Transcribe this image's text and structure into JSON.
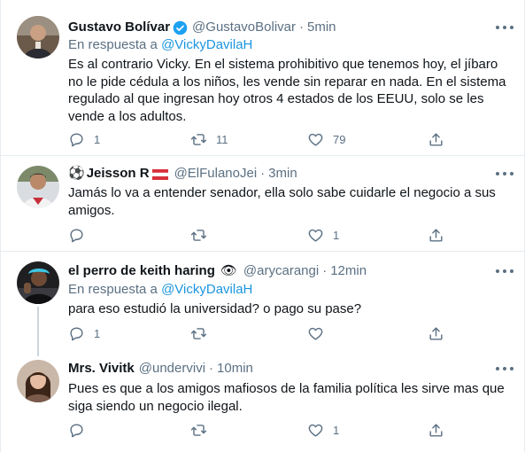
{
  "tweets": [
    {
      "name": "Gustavo Bolívar",
      "handle": "@GustavoBolivar",
      "dot": "·",
      "time": "5min",
      "verified": true,
      "reply_prefix": "En respuesta a ",
      "reply_to": "@VickyDavilaH",
      "text": "Es al contrario Vicky. En el sistema prohibitivo que tenemos hoy, el jíbaro no le pide cédula a los niños, les vende sin reparar en nada. En el sistema regulado al que ingresan hoy otros 4 estados de los EEUU, solo se les vende a los adultos.",
      "replies": "1",
      "retweets": "11",
      "likes": "79"
    },
    {
      "name_prefix_emoji": "⚽",
      "name": "Jeisson R",
      "name_suffix_emoji": "🇦🇹",
      "handle": "@ElFulanoJei",
      "dot": "·",
      "time": "3min",
      "text": "Jamás lo va a entender senador, ella solo sabe cuidarle el negocio a sus amigos.",
      "replies": "",
      "retweets": "",
      "likes": "1"
    },
    {
      "name": "el perro de keith haring",
      "name_suffix_emoji": "👁",
      "handle": "@arycarangi",
      "dot": "·",
      "time": "12min",
      "reply_prefix": "En respuesta a ",
      "reply_to": "@VickyDavilaH",
      "text": "para eso estudió la universidad? o pago su pase?",
      "replies": "1",
      "retweets": "",
      "likes": ""
    },
    {
      "name": "Mrs. Vivitk",
      "handle": "@undervivi",
      "dot": "·",
      "time": "10min",
      "text": "Pues es que a los amigos mafiosos de la familia política les sirve mas que siga siendo un negocio ilegal.",
      "replies": "",
      "retweets": "",
      "likes": "1"
    }
  ],
  "colors": {
    "link": "#1b95e0",
    "secondary_text": "#5b7083",
    "divider": "#e6ecf0",
    "thread_line": "#ccd6dd"
  }
}
